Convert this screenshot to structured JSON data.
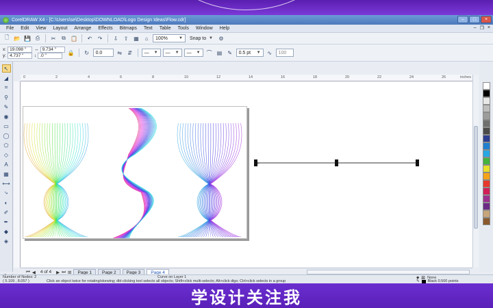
{
  "app": {
    "title": "CorelDRAW X4 - [C:\\Users\\se\\Desktop\\DOWNLOAD\\Logo Design Ideas\\Flow.cdr]"
  },
  "menu": [
    "File",
    "Edit",
    "View",
    "Layout",
    "Arrange",
    "Effects",
    "Bitmaps",
    "Text",
    "Table",
    "Tools",
    "Window",
    "Help"
  ],
  "toolbar": {
    "zoom": "100%",
    "snap_to": "Snap to"
  },
  "property_bar": {
    "x": "19.098 \"",
    "y": "4.737 \"",
    "w": "9.734 \"",
    "h": ".0 \"",
    "angle": "0.0",
    "outline_width": "0.5 pt",
    "smoothing": "100"
  },
  "ruler": {
    "ticks": [
      "0",
      "2",
      "4",
      "6",
      "8",
      "10",
      "12",
      "14",
      "16",
      "18",
      "20",
      "22",
      "24",
      "26"
    ],
    "unit": "inches"
  },
  "pages": {
    "counter": "4 of 4",
    "tabs": [
      "Page 1",
      "Page 2",
      "Page 3",
      "Page 4"
    ],
    "active": "Page 4"
  },
  "status": {
    "nodes": "Number of Nodes: 2",
    "layer": "Curve on Layer 1",
    "coords": "( 5.109 , 8.057 )",
    "hint": "Click an object twice for rotating/skewing; dbl-clicking tool selects all objects; Shift+click multi-selects; Alt+click digs; Ctrl+click selects in a group",
    "fill": "None",
    "outline": "Black  0.500 points"
  },
  "caption": "学设计关注我",
  "colors": {
    "accent": "#6d2fc2",
    "palette": [
      "#ffffff",
      "#000000",
      "#e8e8e8",
      "#bdbdbd",
      "#9c9c9c",
      "#6f6f6f",
      "#4a4a4a",
      "#2c3e91",
      "#1f7fcf",
      "#27a8e3",
      "#43b33d",
      "#e8df2a",
      "#f5a31a",
      "#e6382c",
      "#d11e58",
      "#9b2f8f",
      "#6c2a86",
      "#c7a57a",
      "#8a5a2e"
    ]
  }
}
